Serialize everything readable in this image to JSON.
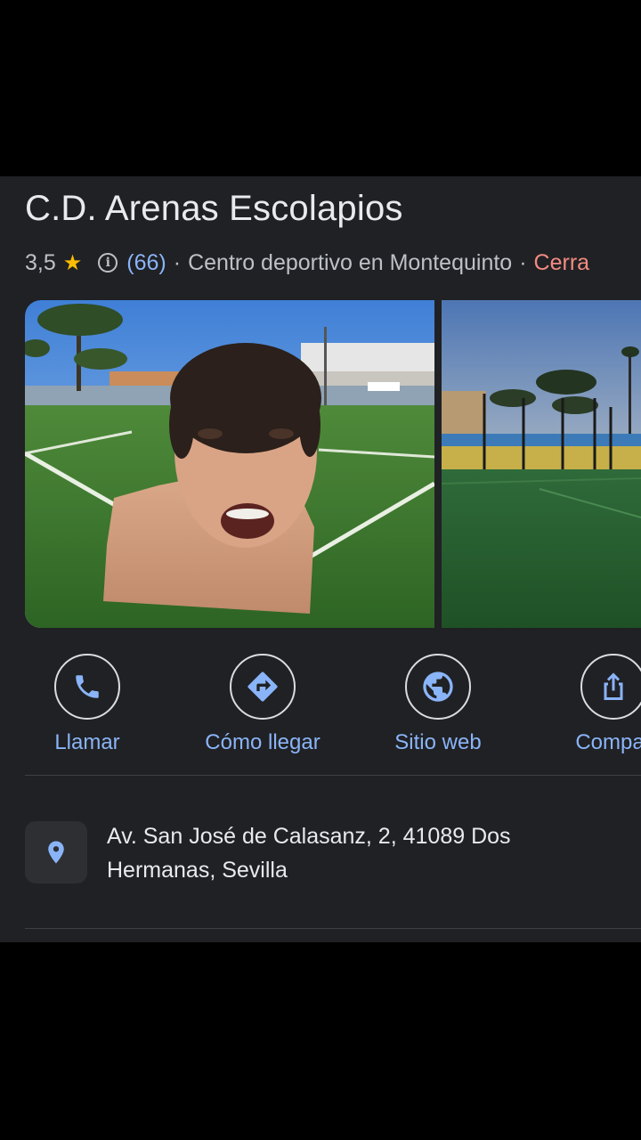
{
  "place": {
    "name": "C.D. Arenas Escolapios",
    "rating": "3,5",
    "star": "★",
    "info_icon": "i",
    "reviews": "(66)",
    "separator": "·",
    "category": "Centro deportivo en Montequinto",
    "status": "Cerra"
  },
  "photos": [
    {
      "icon": "football-field-photo"
    },
    {
      "icon": "football-field-sunset-photo"
    }
  ],
  "actions": [
    {
      "label": "Llamar",
      "icon": "phone-icon"
    },
    {
      "label": "Cómo llegar",
      "icon": "directions-icon"
    },
    {
      "label": "Sitio web",
      "icon": "globe-icon"
    },
    {
      "label": "Compar",
      "icon": "share-icon"
    }
  ],
  "address": {
    "icon": "location-pin-icon",
    "text": "Av. San José de Calasanz, 2, 41089 Dos Hermanas, Sevilla"
  },
  "colors": {
    "background": "#202124",
    "accent": "#8ab4f8",
    "star": "#fbbc04",
    "closed": "#f28b82"
  }
}
